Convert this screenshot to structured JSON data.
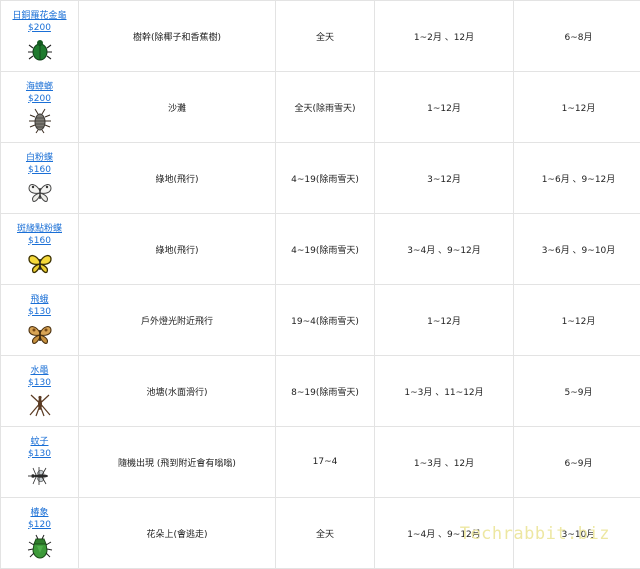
{
  "rows": [
    {
      "name": "日銅羅花金龜",
      "price": "$200",
      "location": "樹幹(除椰子和香蕉樹)",
      "time": "全天",
      "north": "1~2月 、12月",
      "south": "6~8月",
      "icon": "green-beetle-icon"
    },
    {
      "name": "海蟑螂",
      "price": "$200",
      "location": "沙灘",
      "time": "全天(除雨雪天)",
      "north": "1~12月",
      "south": "1~12月",
      "icon": "sea-louse-icon"
    },
    {
      "name": "白粉蝶",
      "price": "$160",
      "location": "綠地(飛行)",
      "time": "4~19(除雨雪天)",
      "north": "3~12月",
      "south": "1~6月 、9~12月",
      "icon": "white-butterfly-icon"
    },
    {
      "name": "斑緣點粉蝶",
      "price": "$160",
      "location": "綠地(飛行)",
      "time": "4~19(除雨雪天)",
      "north": "3~4月 、9~12月",
      "south": "3~6月 、9~10月",
      "icon": "yellow-butterfly-icon"
    },
    {
      "name": "飛蛾",
      "price": "$130",
      "location": "戶外燈光附近飛行",
      "time": "19~4(除雨雪天)",
      "north": "1~12月",
      "south": "1~12月",
      "icon": "moth-icon"
    },
    {
      "name": "水黽",
      "price": "$130",
      "location": "池塘(水面滑行)",
      "time": "8~19(除雨雪天)",
      "north": "1~3月 、11~12月",
      "south": "5~9月",
      "icon": "pondskater-icon"
    },
    {
      "name": "蚊子",
      "price": "$130",
      "location": "隨機出現 (飛到附近會有嗡嗡)",
      "time": "17~4",
      "north": "1~3月 、12月",
      "south": "6~9月",
      "icon": "mosquito-icon"
    },
    {
      "name": "椿象",
      "price": "$120",
      "location": "花朵上(會逃走)",
      "time": "全天",
      "north": "1~4月 、9~12月",
      "south": "3~10月",
      "icon": "stinkbug-icon"
    }
  ],
  "watermark": "Techrabbit.biz"
}
